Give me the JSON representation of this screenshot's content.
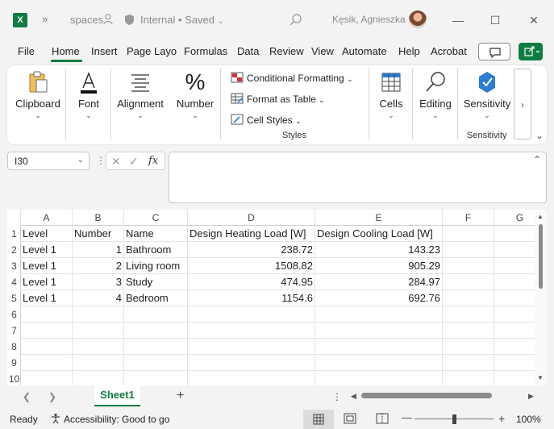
{
  "title": {
    "app_icon": "excel-logo",
    "app_letter": "X",
    "file_name": "spaces",
    "save_status": "Internal • Saved",
    "user_name": "Kęsik, Agnieszka"
  },
  "menu": [
    "File",
    "Home",
    "Insert",
    "Page Layo",
    "Formulas",
    "Data",
    "Review",
    "View",
    "Automate",
    "Help",
    "Acrobat"
  ],
  "ribbon": {
    "clipboard": "Clipboard",
    "font": "Font",
    "alignment": "Alignment",
    "number": "Number",
    "conditional_formatting": "Conditional Formatting",
    "format_as_table": "Format as Table",
    "cell_styles": "Cell Styles",
    "styles_group": "Styles",
    "cells": "Cells",
    "editing": "Editing",
    "sensitivity": "Sensitivity",
    "sensitivity_group": "Sensitivity"
  },
  "formula_bar": {
    "name_box": "I30",
    "fx": "fx",
    "value": ""
  },
  "columns": [
    "A",
    "B",
    "C",
    "D",
    "E",
    "F",
    "G"
  ],
  "rows": [
    "1",
    "2",
    "3",
    "4",
    "5",
    "6",
    "7",
    "8",
    "9",
    "10"
  ],
  "table": {
    "header": [
      "Level",
      "Number",
      "Name",
      "Design Heating Load [W]",
      "Design Cooling Load [W]"
    ],
    "data": [
      [
        "Level 1",
        "1",
        "Bathroom",
        "238.72",
        "143.23"
      ],
      [
        "Level 1",
        "2",
        "Living room",
        "1508.82",
        "905.29"
      ],
      [
        "Level 1",
        "3",
        "Study",
        "474.95",
        "284.97"
      ],
      [
        "Level 1",
        "4",
        "Bedroom",
        "1154.6",
        "692.76"
      ]
    ]
  },
  "sheets": [
    "Sheet1"
  ],
  "status": {
    "ready": "Ready",
    "accessibility": "Accessibility: Good to go",
    "zoom": "100%"
  },
  "colors": {
    "accent": "#107c41"
  }
}
